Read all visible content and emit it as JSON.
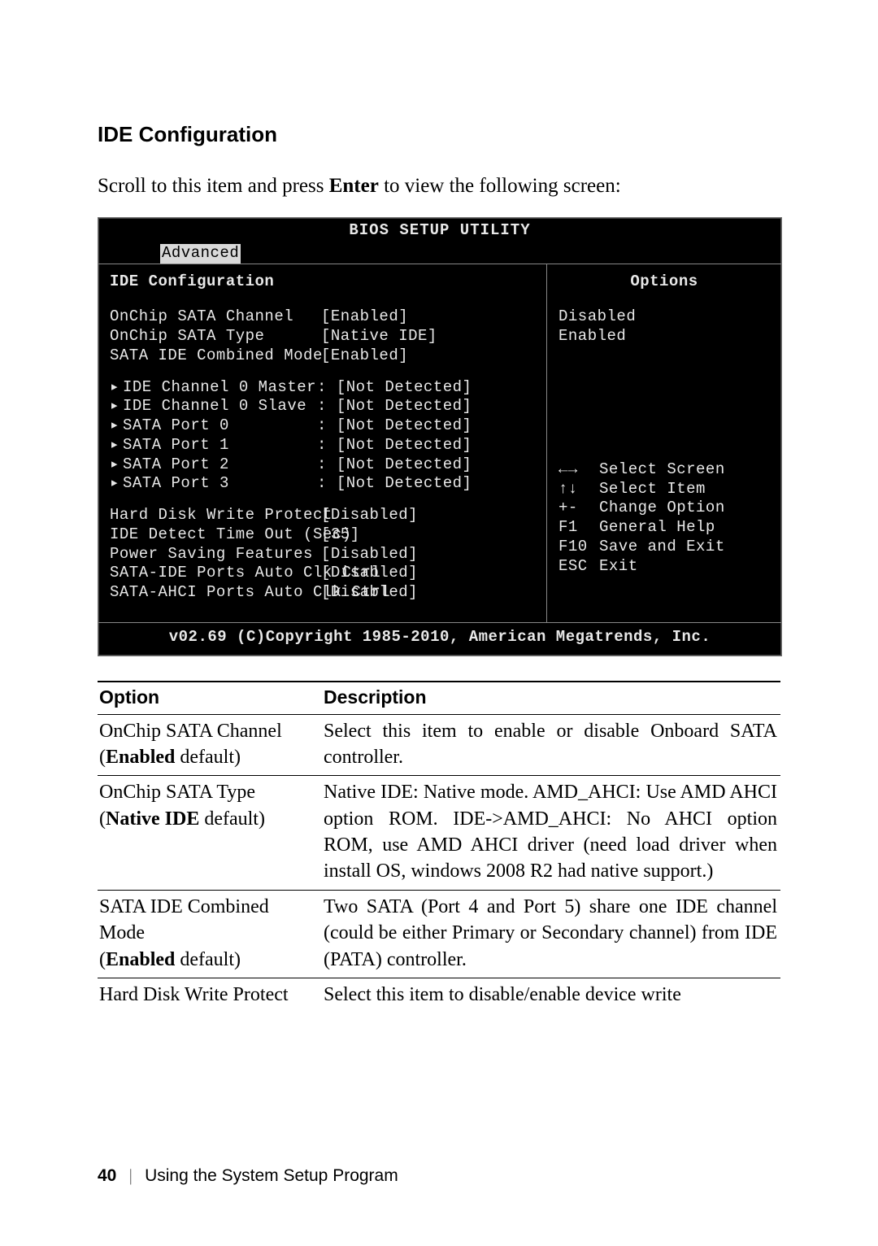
{
  "heading": "IDE Configuration",
  "intro_prefix": "Scroll to this item and press ",
  "intro_key": "Enter",
  "intro_suffix": " to view the following screen:",
  "bios": {
    "title": "BIOS SETUP UTILITY",
    "tab": "Advanced",
    "left_header": "IDE Configuration",
    "right_header": "Options",
    "settings": [
      {
        "label": "OnChip SATA Channel",
        "value": "[Enabled]"
      },
      {
        "label": "OnChip SATA Type",
        "value": "[Native IDE]"
      },
      {
        "label": "SATA IDE Combined Mode",
        "value": "[Enabled]"
      }
    ],
    "devices": [
      {
        "label": "IDE Channel 0 Master",
        "value": "[Not Detected]"
      },
      {
        "label": "IDE Channel 0 Slave",
        "value": "[Not Detected]"
      },
      {
        "label": "SATA Port 0",
        "value": "[Not Detected]"
      },
      {
        "label": "SATA Port 1",
        "value": "[Not Detected]"
      },
      {
        "label": "SATA Port 2",
        "value": "[Not Detected]"
      },
      {
        "label": "SATA Port 3",
        "value": "[Not Detected]"
      }
    ],
    "misc": [
      {
        "label": "Hard Disk Write Protect",
        "value": "[Disabled]"
      },
      {
        "label": "IDE Detect Time Out (Sec)",
        "value": "[35]"
      },
      {
        "label": "Power Saving Features",
        "value": "[Disabled]"
      },
      {
        "label": "SATA-IDE Ports Auto Clk Ctrl",
        "value": "[Disabled]"
      },
      {
        "label": "SATA-AHCI Ports Auto Clk Ctrl",
        "value": "[Disabled]"
      }
    ],
    "option_values": [
      "Disabled",
      "Enabled"
    ],
    "actions": [
      {
        "key": "←→",
        "label": "Select Screen"
      },
      {
        "key": "↑↓",
        "label": "Select Item"
      },
      {
        "key": "+-",
        "label": "Change Option"
      },
      {
        "key": "F1",
        "label": "General Help"
      },
      {
        "key": "F10",
        "label": "Save and Exit"
      },
      {
        "key": "ESC",
        "label": "Exit"
      }
    ],
    "footer": "v02.69 (C)Copyright 1985-2010, American Megatrends, Inc."
  },
  "table": {
    "head_option": "Option",
    "head_desc": "Description",
    "rows": [
      {
        "name": "OnChip SATA Channel",
        "default_bold": "Enabled",
        "default_tail": " default)",
        "desc": "Select this item to enable or disable Onboard SATA controller."
      },
      {
        "name": "OnChip SATA Type",
        "default_bold": "Native IDE",
        "default_tail": " default)",
        "desc": "Native IDE: Native mode.\nAMD_AHCI: Use AMD AHCI option ROM. IDE->AMD_AHCI: No AHCI option ROM, use AMD AHCI driver (need load driver when install OS, windows 2008 R2 had native support.)"
      },
      {
        "name": "SATA IDE Combined Mode",
        "default_bold": "Enabled",
        "default_tail": " default)",
        "desc": "Two SATA (Port 4 and Port 5) share one IDE channel (could be either Primary or Secondary channel) from IDE (PATA) controller."
      },
      {
        "name": "Hard Disk Write Protect",
        "default_bold": "",
        "default_tail": "",
        "desc": "Select this item to disable/enable device write"
      }
    ]
  },
  "footer": {
    "page": "40",
    "chapter": "Using the System Setup Program"
  }
}
